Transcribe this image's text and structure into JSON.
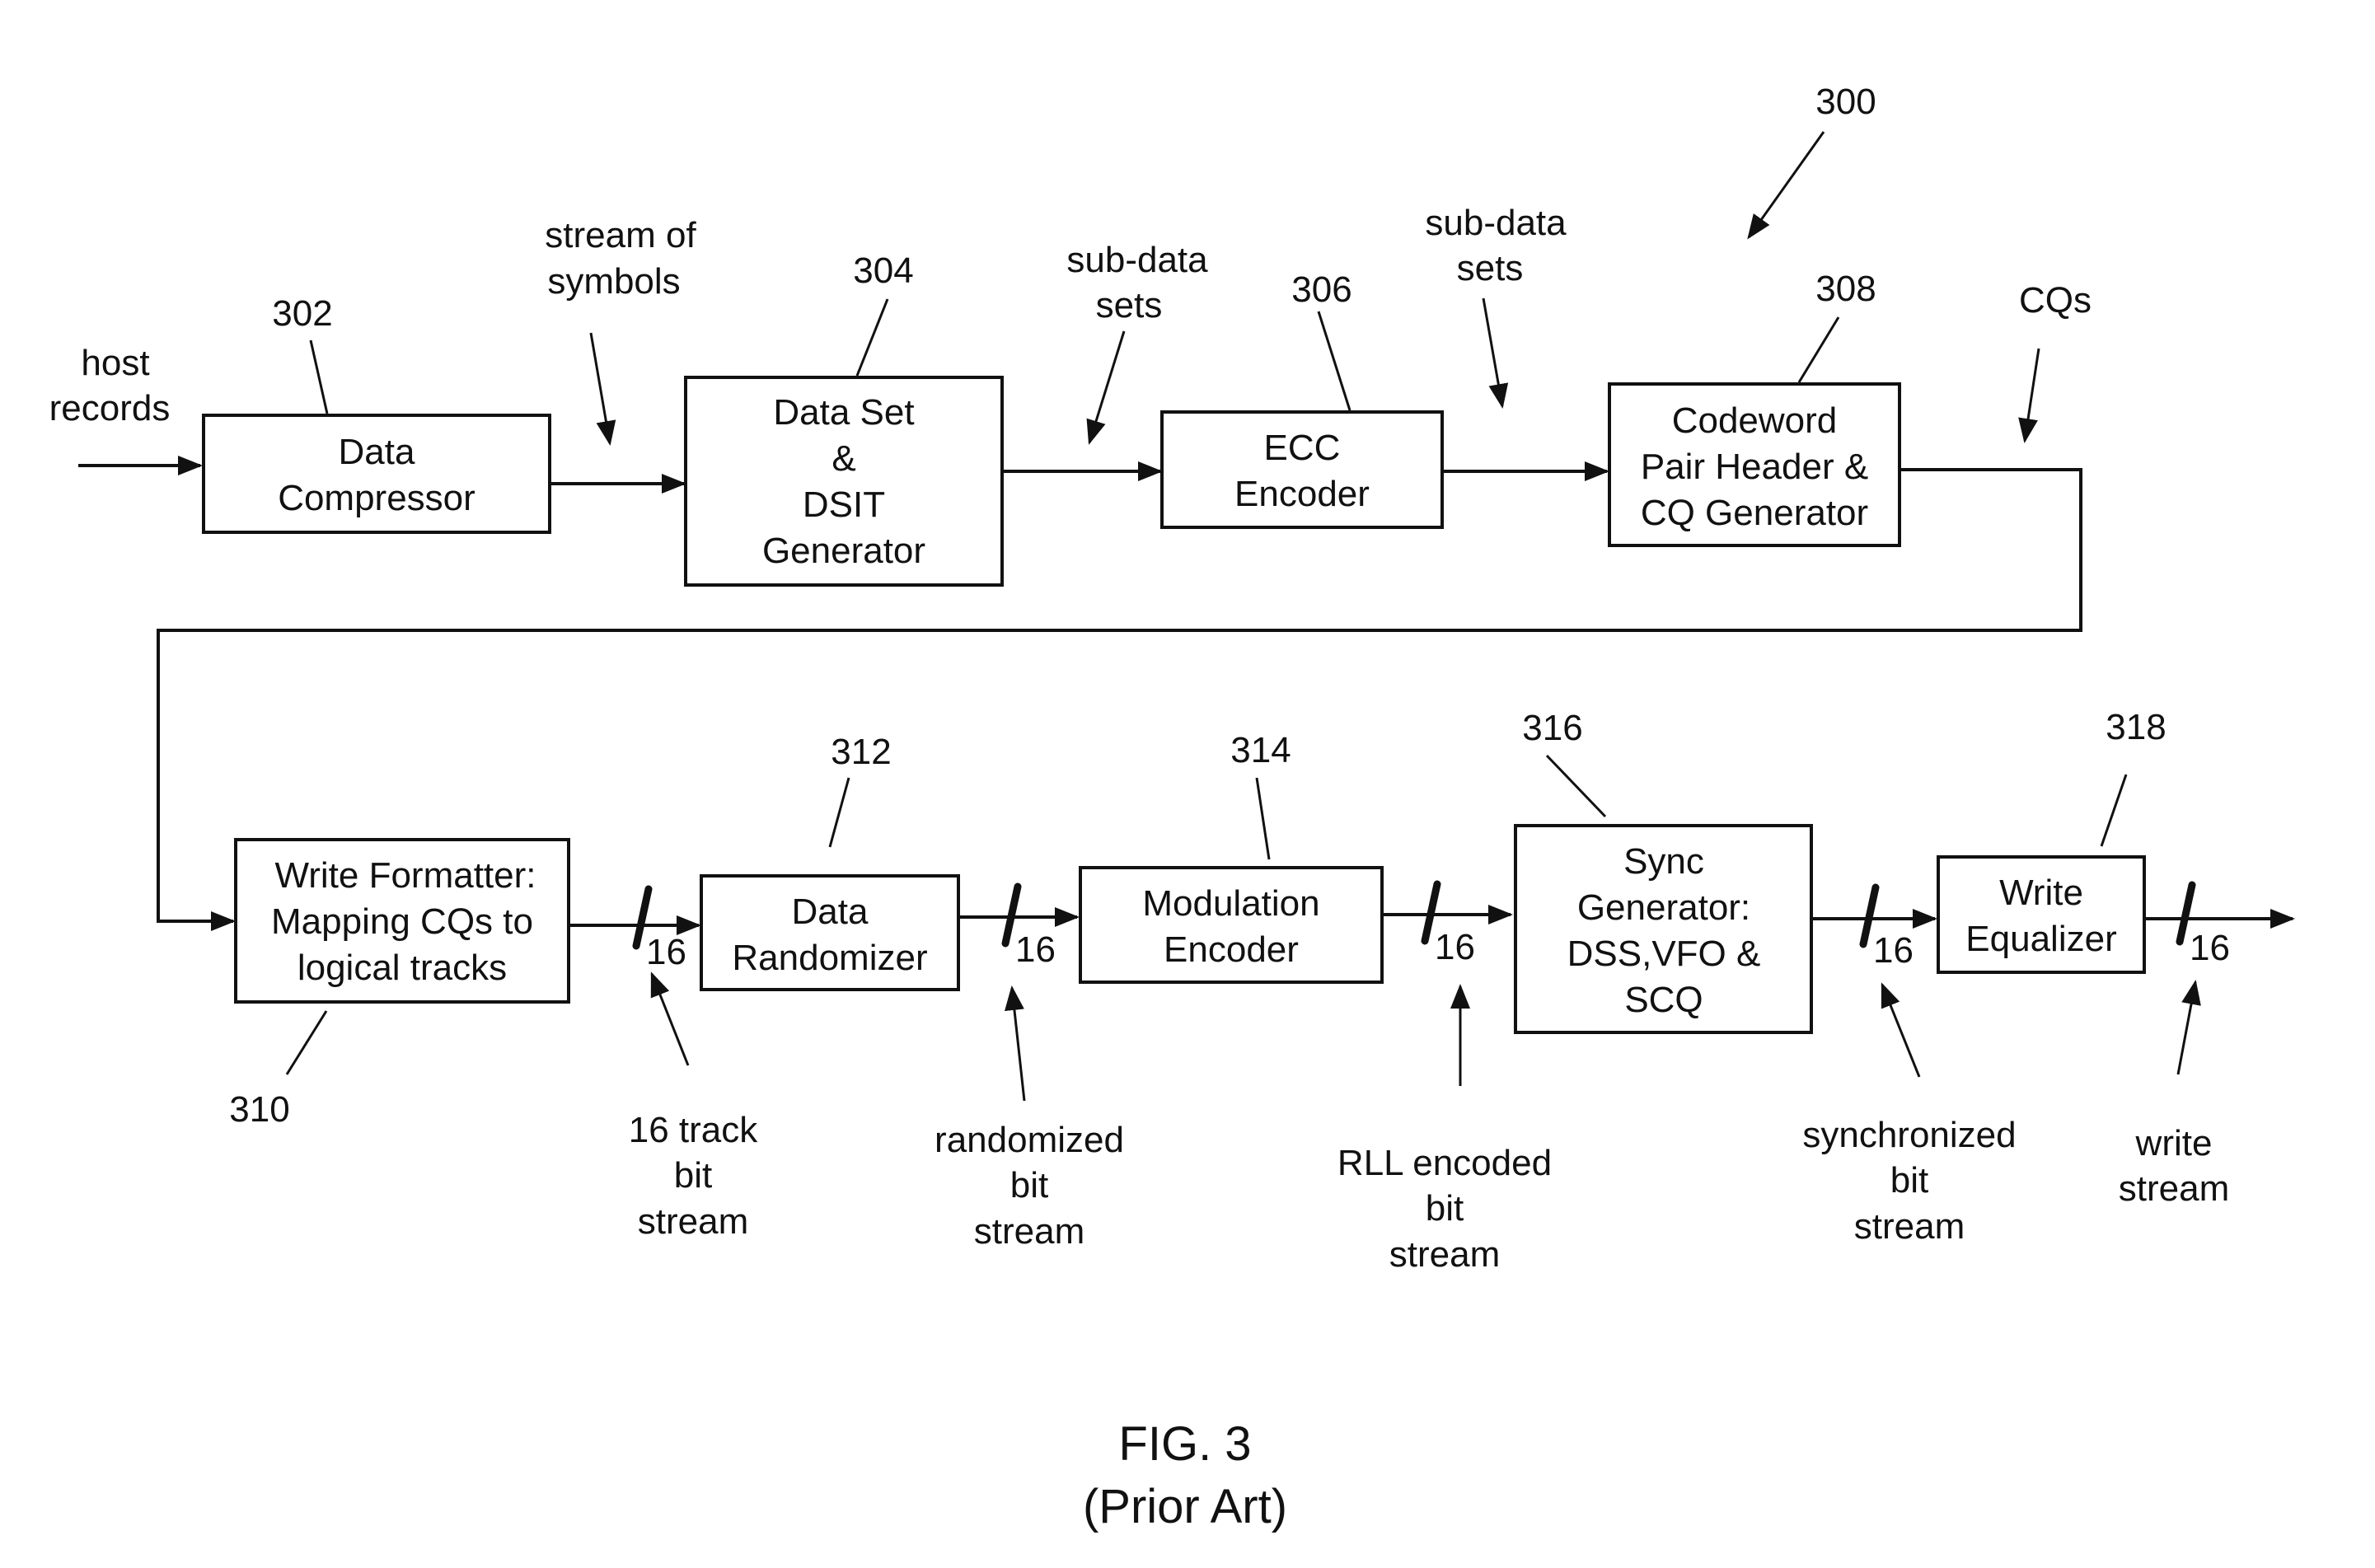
{
  "figure": {
    "reference": "300",
    "caption_title": "FIG. 3",
    "caption_subtitle": "(Prior Art)"
  },
  "blocks": [
    {
      "id": "302",
      "ref": "302",
      "lines": [
        "Data",
        "Compressor"
      ]
    },
    {
      "id": "304",
      "ref": "304",
      "lines": [
        "Data Set",
        "&",
        "DSIT",
        "Generator"
      ]
    },
    {
      "id": "306",
      "ref": "306",
      "lines": [
        "ECC",
        "Encoder"
      ]
    },
    {
      "id": "308",
      "ref": "308",
      "lines": [
        "Codeword",
        "Pair Header &",
        "CQ Generator"
      ]
    },
    {
      "id": "310",
      "ref": "310",
      "lines": [
        "Write Formatter:",
        "Mapping CQs to",
        "logical tracks"
      ]
    },
    {
      "id": "312",
      "ref": "312",
      "lines": [
        "Data",
        "Randomizer"
      ]
    },
    {
      "id": "314",
      "ref": "314",
      "lines": [
        "Modulation",
        "Encoder"
      ]
    },
    {
      "id": "316",
      "ref": "316",
      "lines": [
        "Sync",
        "Generator:",
        "DSS,VFO &",
        "SCQ"
      ]
    },
    {
      "id": "318",
      "ref": "318",
      "lines": [
        "Write",
        "Equalizer"
      ]
    }
  ],
  "signals": [
    {
      "id": "host-records",
      "lines": [
        "host",
        "records"
      ]
    },
    {
      "id": "stream-of-symbols",
      "lines": [
        "stream of",
        "symbols"
      ]
    },
    {
      "id": "sub-data-sets-1",
      "lines": [
        "sub-data",
        "sets"
      ]
    },
    {
      "id": "sub-data-sets-2",
      "lines": [
        "sub-data",
        "sets"
      ]
    },
    {
      "id": "cqs",
      "lines": [
        "CQs"
      ]
    },
    {
      "id": "16-track-bit-stream",
      "lines": [
        "16 track",
        "bit",
        "stream"
      ]
    },
    {
      "id": "randomized-bit-stream",
      "lines": [
        "randomized",
        "bit",
        "stream"
      ]
    },
    {
      "id": "rll-encoded-bit-stream",
      "lines": [
        "RLL encoded",
        "bit",
        "stream"
      ]
    },
    {
      "id": "synchronized-bit-stream",
      "lines": [
        "synchronized",
        "bit",
        "stream"
      ]
    },
    {
      "id": "write-stream",
      "lines": [
        "write",
        "stream"
      ]
    }
  ],
  "bus_width": "16",
  "colors": {
    "ink": "#111111",
    "background": "#ffffff"
  }
}
